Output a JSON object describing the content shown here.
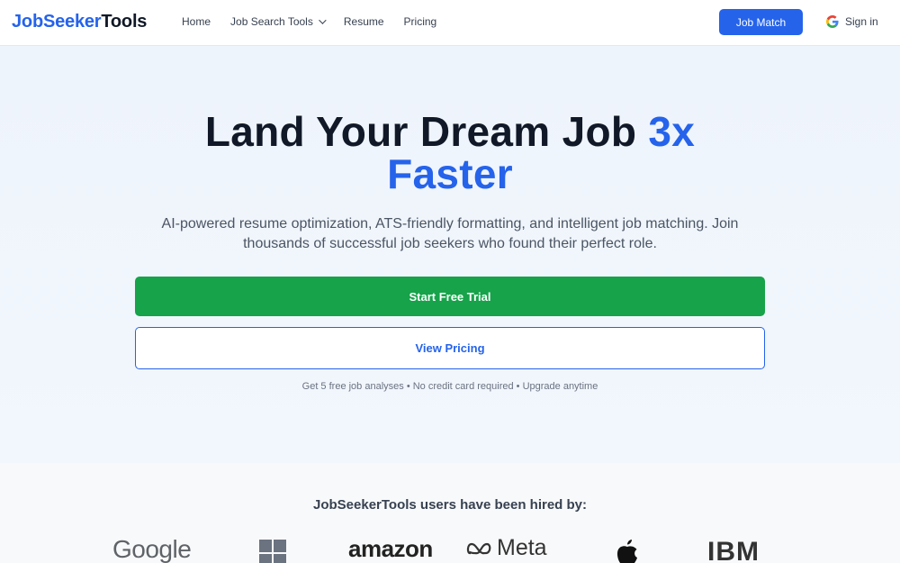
{
  "header": {
    "logo_part1": "JobSeeker",
    "logo_part2": "Tools",
    "nav": [
      {
        "label": "Home"
      },
      {
        "label": "Job Search Tools"
      },
      {
        "label": "Resume"
      },
      {
        "label": "Pricing"
      }
    ],
    "job_match_label": "Job Match",
    "sign_in_label": "Sign in"
  },
  "hero": {
    "title_part1": "Land Your Dream Job ",
    "title_accent1": "3x",
    "title_accent2": "Faster",
    "subtitle": "AI-powered resume optimization, ATS-friendly formatting, and intelligent job matching. Join thousands of successful job seekers who found their perfect role.",
    "primary_cta": "Start Free Trial",
    "secondary_cta": "View Pricing",
    "fine_print": "Get 5 free job analyses • No credit card required • Upgrade anytime"
  },
  "hired": {
    "title": "JobSeekerTools users have been hired by:",
    "companies": [
      {
        "name": "Google"
      },
      {
        "name": "microsoft-logo"
      },
      {
        "name": "amazon"
      },
      {
        "name": "Meta"
      },
      {
        "name": "apple-logo"
      },
      {
        "name": "IBM"
      }
    ]
  },
  "colors": {
    "brand_blue": "#2563eb",
    "cta_green": "#16a34a",
    "hero_bg": "#eef4fc"
  }
}
